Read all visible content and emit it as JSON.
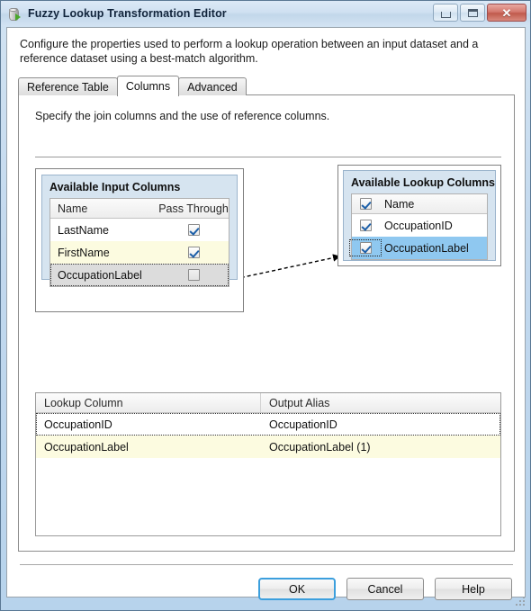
{
  "window": {
    "title": "Fuzzy Lookup Transformation Editor",
    "icon": "data-transform-icon",
    "controls": {
      "minimize": "–",
      "maximize": "□",
      "close": "✕"
    }
  },
  "description": "Configure the properties used to perform a lookup operation between an input dataset and a reference dataset using a best-match algorithm.",
  "tabs": [
    {
      "label": "Reference Table",
      "active": false
    },
    {
      "label": "Columns",
      "active": true
    },
    {
      "label": "Advanced",
      "active": false
    }
  ],
  "page": {
    "hint": "Specify the join columns and the use of reference columns."
  },
  "input_panel": {
    "title": "Available Input Columns",
    "headers": {
      "name": "Name",
      "pass_through": "Pass Through"
    },
    "rows": [
      {
        "name": "LastName",
        "checked": true,
        "style": "normal"
      },
      {
        "name": "FirstName",
        "checked": true,
        "style": "yellow"
      },
      {
        "name": "OccupationLabel",
        "checked": false,
        "style": "gray-focus"
      }
    ]
  },
  "lookup_panel": {
    "title": "Available Lookup Columns",
    "header": {
      "checked": true,
      "name": "Name"
    },
    "rows": [
      {
        "name": "OccupationID",
        "checked": true,
        "style": "normal"
      },
      {
        "name": "OccupationLabel",
        "checked": true,
        "style": "selected"
      }
    ]
  },
  "output_grid": {
    "headers": {
      "lookup_column": "Lookup Column",
      "output_alias": "Output Alias"
    },
    "rows": [
      {
        "lookup_column": "OccupationID",
        "output_alias": "OccupationID",
        "style": "focus"
      },
      {
        "lookup_column": "OccupationLabel",
        "output_alias": "OccupationLabel (1)",
        "style": "yellow"
      }
    ]
  },
  "footer": {
    "ok": "OK",
    "cancel": "Cancel",
    "help": "Help"
  },
  "colors": {
    "panel_fill": "#d6e4f0",
    "selection_blue": "#8fc8f0",
    "row_yellow": "#fcfbe0",
    "focus_ring": "#3c9fdd",
    "close_red": "#c05a4c"
  }
}
